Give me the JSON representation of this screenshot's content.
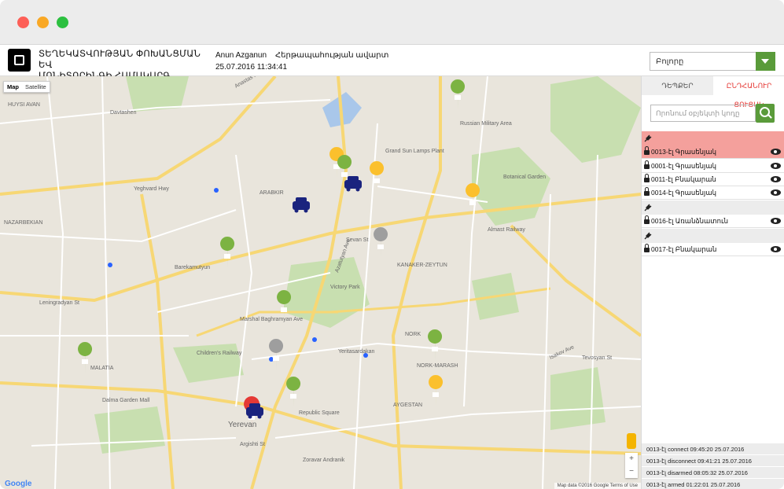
{
  "window": {
    "controls": [
      "close",
      "minimize",
      "maximize"
    ]
  },
  "header": {
    "title_line1": "ՏԵՂԵԿԱՏՎՈՒԹՅԱՆ ՓՈԽԱՆՑՄԱՆ ԵՎ",
    "title_line2": "ՄՈՆԻՏՈՐԻՆԳԻ ՀԱՄԱԿԱՐԳ",
    "user": "Anun Azganun",
    "exit": "Հերթապահության ավարտ",
    "datetime": "25.07.2016 11:34:41",
    "select_value": "Բոլորը"
  },
  "map": {
    "type_buttons": [
      "Map",
      "Satellite"
    ],
    "zoom_in": "+",
    "zoom_out": "−",
    "attribution": "Map data ©2016 Google   Terms of Use",
    "google": "Google"
  },
  "panel": {
    "tabs": [
      "ԴԵՊՔԵՐ",
      "ԸՆԴՀԱՆՈՒՐ ՑՈՒՑԱԿ"
    ],
    "search_placeholder": "Որոնում օբյեկտի կոդը",
    "items": [
      {
        "label": "0013-էլ Գրասենյակ",
        "highlight": true
      },
      {
        "label": "0001-էլ Գրասենյակ",
        "highlight": false
      },
      {
        "label": "0011-էլ Բնակարան",
        "highlight": false
      },
      {
        "label": "0014-էլ Գրասենյակ",
        "highlight": false
      },
      {
        "label": "0016-էլ Առանձնատուն",
        "highlight": false
      },
      {
        "label": "0017-էլ Բնակարան",
        "highlight": false
      }
    ],
    "log": [
      "0013-էլ connect 09:45:20 25.07.2016",
      "0013-էլ disconnect 09:41:21 25.07.2016",
      "0013-էլ disarmed 08:05:32 25.07.2016",
      "0013-էլ armed 01:22:01 25.07.2016"
    ]
  },
  "colors": {
    "accent_green": "#5a9b3a",
    "alert_red": "#f4a09c",
    "tab_active": "#e53935"
  },
  "map_labels": [
    "ARABKIR",
    "NORK",
    "KANAKER-ZEYTUN",
    "NAZARBEKIAN",
    "MALATIA",
    "NORK-MARASH",
    "AYGESTAN",
    "Yerevan",
    "Anastas Mikoyan St",
    "Yeghvard Hwy",
    "Leningradyan St",
    "Victory Park",
    "Republic Square",
    "Children's Railway",
    "Dalma Garden Mall",
    "Botanical Garden",
    "Russian Military Area",
    "Almast Railway",
    "Grand Sun Lamps Plant",
    "Barekamutyun",
    "Marshal Baghramyan Ave",
    "Azatutyan Ave",
    "Isakov Ave",
    "Tevosyan St",
    "Yeritasardakan",
    "Zoravar Andranik",
    "Argishti St",
    "Davtashen",
    "HUYSI AVAN",
    "Sevan St"
  ]
}
